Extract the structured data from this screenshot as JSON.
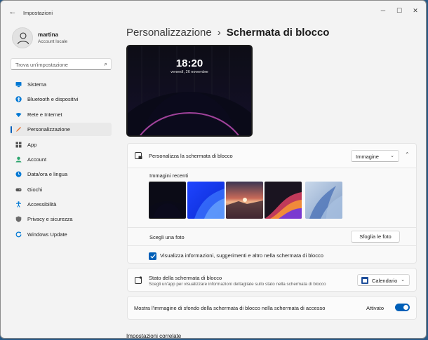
{
  "window": {
    "app_title": "Impostazioni",
    "back_icon": "←",
    "minimize_icon": "─",
    "maximize_icon": "☐",
    "close_icon": "✕"
  },
  "user": {
    "name": "martina",
    "account_type": "Account locale"
  },
  "search": {
    "placeholder": "Trova un'impostazione"
  },
  "sidebar": {
    "items": [
      {
        "label": "Sistema",
        "icon": "monitor-icon",
        "color": "#0078d4"
      },
      {
        "label": "Bluetooth e dispositivi",
        "icon": "bluetooth-icon",
        "color": "#0078d4"
      },
      {
        "label": "Rete e Internet",
        "icon": "wifi-icon",
        "color": "#0078d4"
      },
      {
        "label": "Personalizzazione",
        "icon": "brush-icon",
        "color": "#e9732e"
      },
      {
        "label": "App",
        "icon": "apps-icon",
        "color": "#555555"
      },
      {
        "label": "Account",
        "icon": "account-icon",
        "color": "#2da56e"
      },
      {
        "label": "Data/ora e lingua",
        "icon": "globe-clock-icon",
        "color": "#0078d4"
      },
      {
        "label": "Giochi",
        "icon": "gamepad-icon",
        "color": "#555555"
      },
      {
        "label": "Accessibilità",
        "icon": "accessibility-icon",
        "color": "#0078d4"
      },
      {
        "label": "Privacy e sicurezza",
        "icon": "shield-icon",
        "color": "#6b6b6b"
      },
      {
        "label": "Windows Update",
        "icon": "update-icon",
        "color": "#0078d4"
      }
    ],
    "active_index": 3
  },
  "breadcrumb": {
    "parent": "Personalizzazione",
    "separator": "›",
    "current": "Schermata di blocco"
  },
  "preview": {
    "time": "18:20",
    "date": "venerdì, 26 novembre"
  },
  "personalize": {
    "label": "Personalizza la schermata di blocco",
    "dropdown_value": "Immagine",
    "recent_images_label": "Immagini recenti",
    "choose_photo_label": "Scegli una foto",
    "browse_button": "Sfoglia le foto",
    "checkbox_label": "Visualizza informazioni, suggerimenti e altro nella schermata di blocco",
    "checkbox_checked": true
  },
  "status": {
    "label": "Stato della schermata di blocco",
    "description": "Scegli un'app per visualizzare informazioni dettagliate sullo stato nella schermata di blocco",
    "dropdown_value": "Calendario"
  },
  "signin_background": {
    "label": "Mostra l'immagine di sfondo della schermata di blocco nella schermata di accesso",
    "state_label": "Attivato",
    "enabled": true
  },
  "related": {
    "heading": "Impostazioni correlate"
  },
  "colors": {
    "accent": "#005fb8"
  }
}
